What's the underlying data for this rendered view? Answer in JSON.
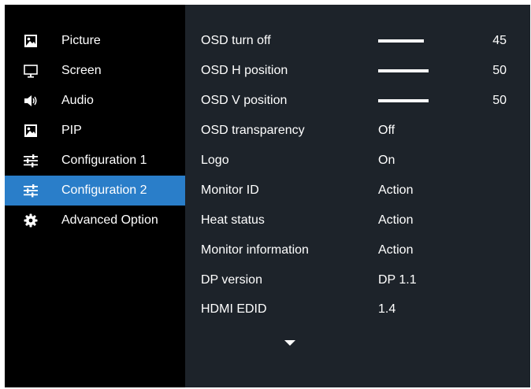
{
  "sidebar": {
    "items": [
      {
        "label": "Picture",
        "icon": "picture-icon",
        "selected": false
      },
      {
        "label": "Screen",
        "icon": "monitor-icon",
        "selected": false
      },
      {
        "label": "Audio",
        "icon": "speaker-icon",
        "selected": false
      },
      {
        "label": "PIP",
        "icon": "pip-icon",
        "selected": false
      },
      {
        "label": "Configuration 1",
        "icon": "sliders-icon",
        "selected": false
      },
      {
        "label": "Configuration 2",
        "icon": "sliders-icon",
        "selected": true
      },
      {
        "label": "Advanced Option",
        "icon": "gear-icon",
        "selected": false
      }
    ]
  },
  "settings": {
    "rows": [
      {
        "label": "OSD turn off",
        "value": "45",
        "type": "slider",
        "fill": 0.45
      },
      {
        "label": "OSD H position",
        "value": "50",
        "type": "slider",
        "fill": 0.5
      },
      {
        "label": "OSD V position",
        "value": "50",
        "type": "slider",
        "fill": 0.5
      },
      {
        "label": "OSD transparency",
        "value": "Off",
        "type": "option"
      },
      {
        "label": "Logo",
        "value": "On",
        "type": "option"
      },
      {
        "label": "Monitor ID",
        "value": "Action",
        "type": "option"
      },
      {
        "label": "Heat status",
        "value": "Action",
        "type": "option"
      },
      {
        "label": "Monitor information",
        "value": "Action",
        "type": "option"
      },
      {
        "label": "DP version",
        "value": "DP 1.1",
        "type": "option"
      },
      {
        "label": "HDMI EDID",
        "value": "1.4",
        "type": "option"
      }
    ],
    "scroll_icon": "chevron-down-icon"
  },
  "colors": {
    "sidebar_bg": "#000000",
    "panel_bg": "#1d232a",
    "selected_bg": "#2a7ec9",
    "text": "#ffffff"
  }
}
